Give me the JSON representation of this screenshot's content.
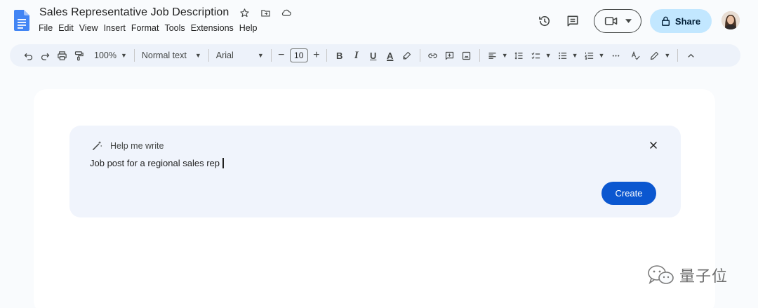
{
  "document": {
    "title": "Sales Representative Job Description"
  },
  "menu": [
    "File",
    "Edit",
    "View",
    "Insert",
    "Format",
    "Tools",
    "Extensions",
    "Help"
  ],
  "header": {
    "share_label": "Share"
  },
  "toolbar": {
    "zoom": "100%",
    "style": "Normal text",
    "font": "Arial",
    "font_size": "10",
    "bold": "B",
    "italic": "I",
    "underline": "U",
    "text_color": "A"
  },
  "help_me_write": {
    "title": "Help me write",
    "prompt": "Job post for a regional sales rep",
    "create_label": "Create"
  },
  "watermark": {
    "text": "量子位"
  },
  "colors": {
    "accent": "#0b57d0",
    "share_bg": "#c2e7ff",
    "toolbar_bg": "#edf2fa",
    "card_bg": "#f0f4fc"
  }
}
